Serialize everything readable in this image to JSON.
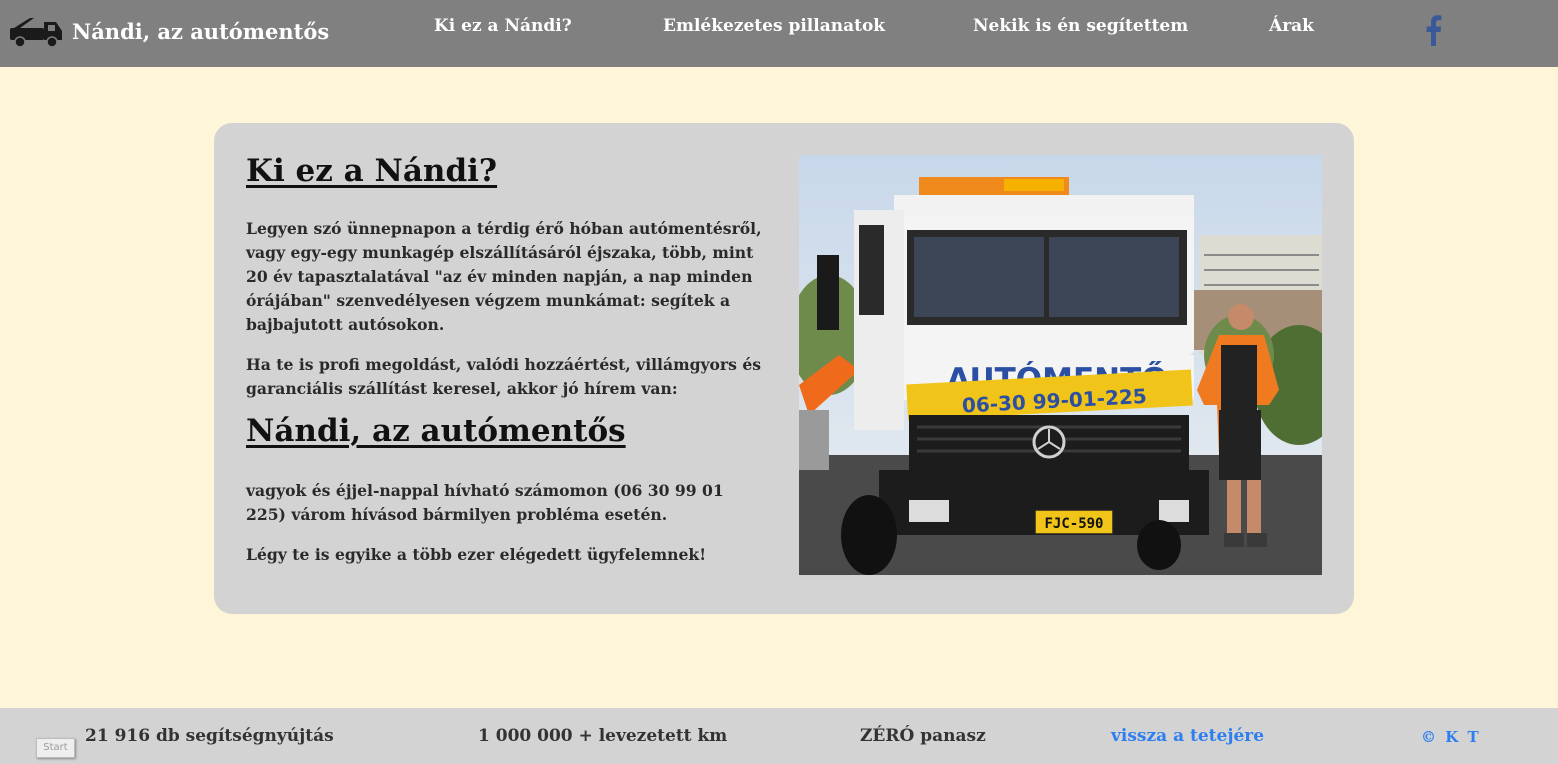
{
  "header": {
    "brand_name": "Nándi, az autómentős",
    "brand_icon": "tow-truck-icon",
    "nav": [
      {
        "label": "Ki ez a Nándi?"
      },
      {
        "label": "Emlékezetes pillanatok"
      },
      {
        "label": "Nekik is én segítettem"
      },
      {
        "label": "Árak"
      }
    ],
    "social_icon": "facebook-icon",
    "social_color": "#3b5998"
  },
  "main": {
    "title": "Ki ez a Nándi?",
    "paragraph1": "Legyen szó ünnepnapon a térdig érő hóban autómentésről, vagy egy-egy munkagép elszállításáról éjszaka, több, mint 20 év tapasztalatával \"az év minden napján, a nap minden órájában\" szenvedélyesen végzem munkámat: segítek a bajbajutott autósokon.",
    "paragraph2": "Ha te is profi megoldást, valódi hozzáértést, villámgyors és garanciális szállítást keresel, akkor jó hírem van:",
    "subtitle": "Nándi, az autómentős",
    "paragraph3": "vagyok és éjjel-nappal hívható számomon (06 30 99 01 225) várom hívásod bármilyen probléma esetén.",
    "paragraph4": "Légy te is egyike a több ezer elégedett ügyfelemnek!",
    "photo": {
      "sign_text": "AUTÓMENTŐ",
      "phone_text": "06-30 99-01-225",
      "plate_text": "FJC-590"
    }
  },
  "footer": {
    "stat1": "21 916 db segítségnyújtás",
    "stat2": "1 000 000 + levezetett km",
    "stat3": "ZÉRÓ panasz",
    "back_to_top": "vissza a tetejére",
    "copyright": "© K T",
    "link_color": "#2d7ff0"
  },
  "widget": {
    "start_label": "Start"
  }
}
